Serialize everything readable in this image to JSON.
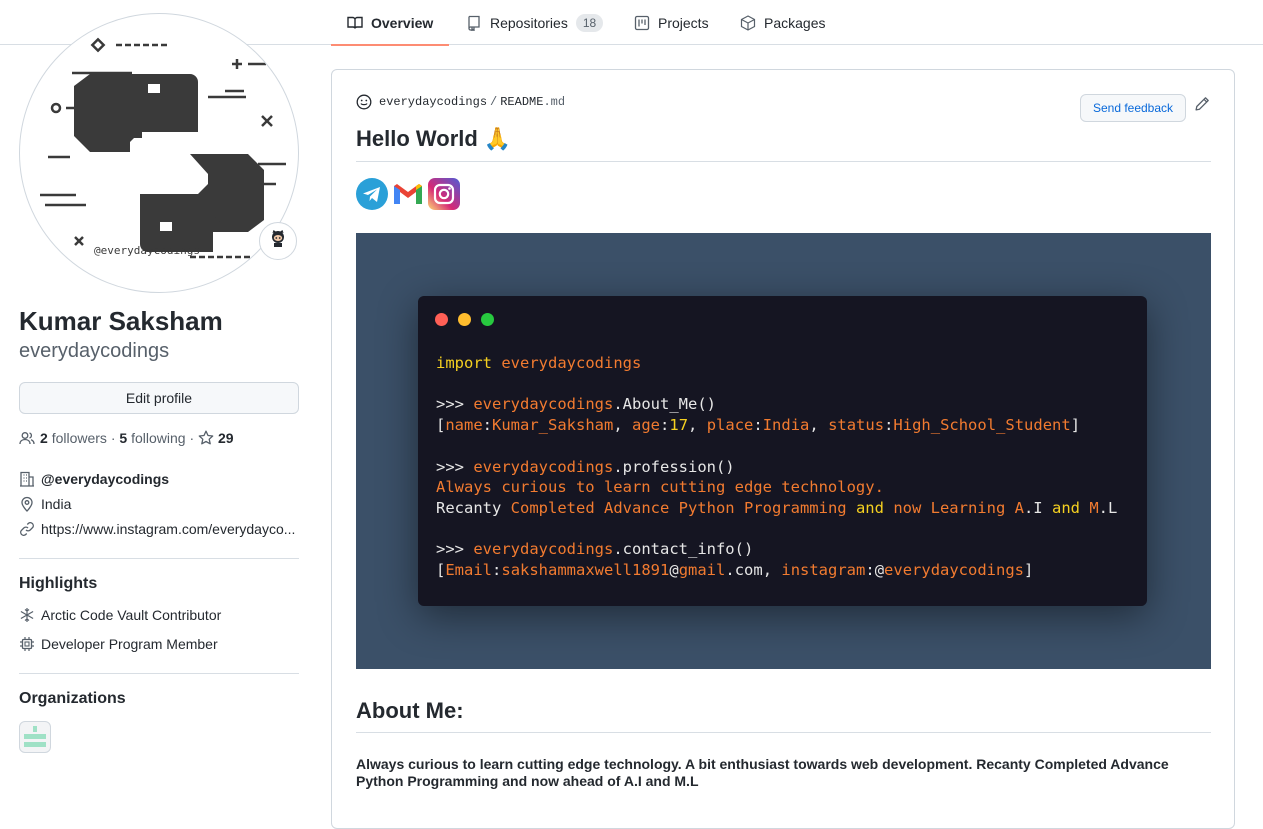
{
  "tabs": [
    {
      "label": "Overview",
      "icon": "book-icon",
      "active": true
    },
    {
      "label": "Repositories",
      "icon": "repo-icon",
      "count": "18"
    },
    {
      "label": "Projects",
      "icon": "project-icon"
    },
    {
      "label": "Packages",
      "icon": "package-icon"
    }
  ],
  "profile": {
    "avatar_caption": "@everydaycodings",
    "fullname": "Kumar Saksham",
    "username": "everydaycodings",
    "edit_label": "Edit profile",
    "followers_count": "2",
    "followers_label": "followers",
    "following_count": "5",
    "following_label": "following",
    "stars_count": "29",
    "sep": "·",
    "organization": "@everydaycodings",
    "location": "India",
    "website": "https://www.instagram.com/everydayco..."
  },
  "highlights": {
    "title": "Highlights",
    "items": [
      "Arctic Code Vault Contributor",
      "Developer Program Member"
    ]
  },
  "organizations": {
    "title": "Organizations"
  },
  "readme": {
    "owner": "everydaycodings",
    "sep": "/",
    "file": "README",
    "ext": ".md",
    "feedback_label": "Send feedback",
    "title": "Hello World 🙏",
    "about_title": "About Me:",
    "about_text": "Always curious to learn cutting edge technology. A bit enthusiast towards web development. Recanty Completed Advance Python Programming and now ahead of A.I and M.L"
  },
  "terminal": {
    "l1_kw": "import",
    "l1_mod": "everydaycodings",
    "prompt": ">>>",
    "mod": "everydaycodings",
    "about_fn": ".About_Me()",
    "profession_fn": ".profession()",
    "contact_fn": ".contact_info()",
    "name_key": "name",
    "name_val": "Kumar_Saksham",
    "age_key": "age",
    "age_val": "17",
    "place_key": "place",
    "place_val": "India",
    "status_key": "status",
    "status_val": "High_School_Student",
    "prof_line1": "Always curious to learn cutting edge technology.",
    "prof_l2_a": "Recanty",
    "prof_l2_b": "Completed Advance Python Programming",
    "prof_l2_and1": "and",
    "prof_l2_c": "now Learning A",
    "prof_l2_d": ".I",
    "prof_l2_and2": "and",
    "prof_l2_e": "M",
    "prof_l2_f": ".L",
    "email_key": "Email",
    "email_user": "sakshammaxwell1891",
    "email_at": "@",
    "email_dom": "gmail",
    "email_tld": ".com",
    "insta_key": "instagram",
    "insta_at": ":@",
    "insta_val": "everydaycodings"
  },
  "colors": {
    "accent": "#fd8c73",
    "link": "#0969da",
    "banner": "#3b5068",
    "terminal": "#151522",
    "code_orange": "#f27b30",
    "code_yellow": "#f5d020"
  }
}
